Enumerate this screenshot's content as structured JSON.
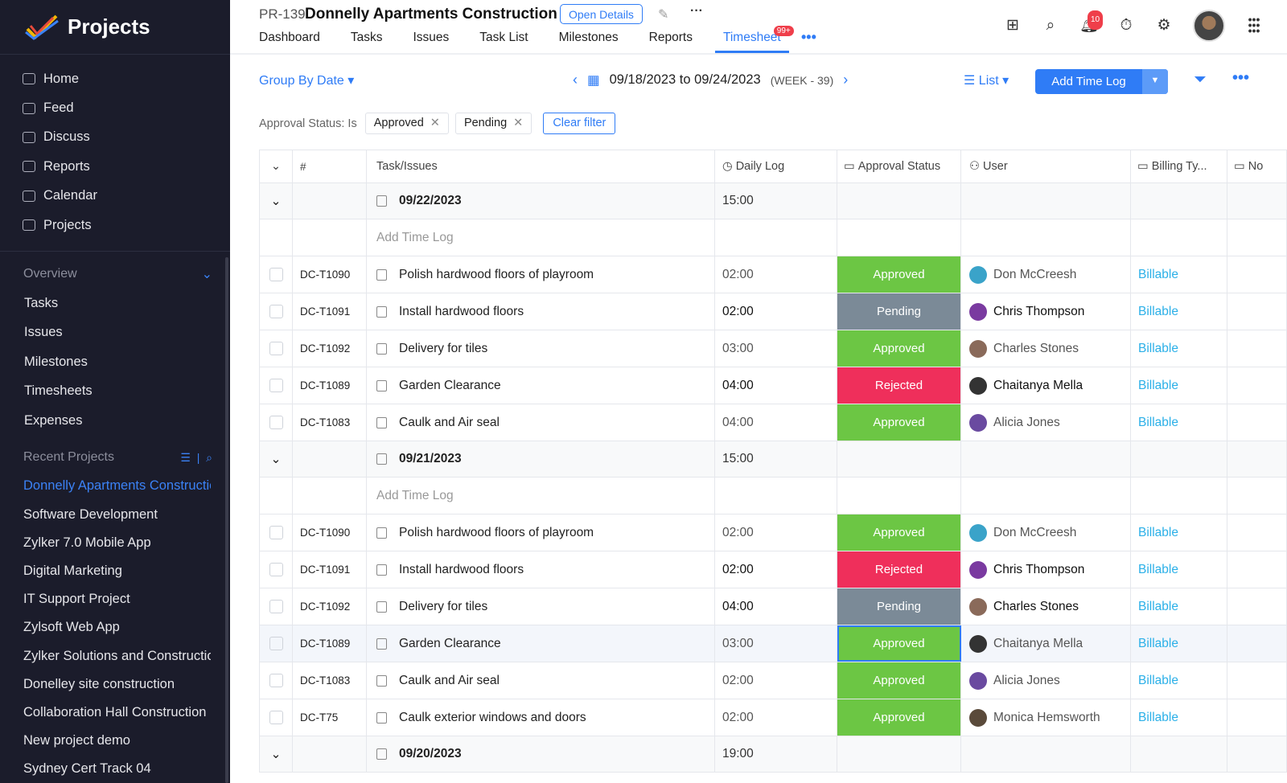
{
  "app": {
    "title": "Projects"
  },
  "sidebar": {
    "items": [
      {
        "label": "Home"
      },
      {
        "label": "Feed"
      },
      {
        "label": "Discuss"
      },
      {
        "label": "Reports"
      },
      {
        "label": "Calendar"
      },
      {
        "label": "Projects"
      }
    ],
    "overview": {
      "title": "Overview",
      "items": [
        {
          "label": "Tasks"
        },
        {
          "label": "Issues"
        },
        {
          "label": "Milestones"
        },
        {
          "label": "Timesheets"
        },
        {
          "label": "Expenses"
        }
      ]
    },
    "recent": {
      "title": "Recent Projects",
      "items": [
        {
          "label": "Donnelly Apartments Construction",
          "active": true
        },
        {
          "label": "Software Development"
        },
        {
          "label": "Zylker 7.0 Mobile App"
        },
        {
          "label": "Digital Marketing"
        },
        {
          "label": "IT Support Project"
        },
        {
          "label": "Zylsoft Web App"
        },
        {
          "label": "Zylker Solutions and Construction"
        },
        {
          "label": "Donelley site construction"
        },
        {
          "label": "Collaboration Hall Construction"
        },
        {
          "label": "New project demo"
        },
        {
          "label": "Sydney Cert Track 04"
        }
      ]
    }
  },
  "header": {
    "project_id": "PR-139",
    "project_title": "Donnelly Apartments Construction",
    "open_details": "Open Details",
    "tabs": [
      {
        "label": "Dashboard"
      },
      {
        "label": "Tasks"
      },
      {
        "label": "Issues"
      },
      {
        "label": "Task List"
      },
      {
        "label": "Milestones"
      },
      {
        "label": "Reports"
      },
      {
        "label": "Timesheet",
        "active": true,
        "badge": "99+"
      }
    ],
    "notifications": "10"
  },
  "toolbar": {
    "group_by": "Group By Date",
    "date_range": "09/18/2023 to 09/24/2023",
    "week": "(WEEK - 39)",
    "view": "List",
    "add_time_log": "Add Time Log"
  },
  "filters": {
    "label": "Approval Status: Is",
    "chips": [
      "Approved",
      "Pending"
    ],
    "clear": "Clear filter"
  },
  "table": {
    "columns": [
      "#",
      "Task/Issues",
      "Daily Log",
      "Approval Status",
      "User",
      "Billing Ty...",
      "No"
    ],
    "add_time_log": "Add Time Log",
    "groups": [
      {
        "date": "09/22/2023",
        "total": "15:00",
        "rows": [
          {
            "id": "DC-T1090",
            "task": "Polish hardwood floors of playroom",
            "log": "02:00",
            "status": "Approved",
            "user": "Don McCreesh",
            "billing": "Billable"
          },
          {
            "id": "DC-T1091",
            "task": "Install hardwood floors",
            "log": "02:00",
            "status": "Pending",
            "user": "Chris Thompson",
            "billing": "Billable",
            "strong": true
          },
          {
            "id": "DC-T1092",
            "task": "Delivery for tiles",
            "log": "03:00",
            "status": "Approved",
            "user": "Charles Stones",
            "billing": "Billable"
          },
          {
            "id": "DC-T1089",
            "task": "Garden Clearance",
            "log": "04:00",
            "status": "Rejected",
            "user": "Chaitanya Mella",
            "billing": "Billable",
            "strong": true
          },
          {
            "id": "DC-T1083",
            "task": "Caulk and Air seal",
            "log": "04:00",
            "status": "Approved",
            "user": "Alicia Jones",
            "billing": "Billable"
          }
        ]
      },
      {
        "date": "09/21/2023",
        "total": "15:00",
        "rows": [
          {
            "id": "DC-T1090",
            "task": "Polish hardwood floors of playroom",
            "log": "02:00",
            "status": "Approved",
            "user": "Don McCreesh",
            "billing": "Billable"
          },
          {
            "id": "DC-T1091",
            "task": "Install hardwood floors",
            "log": "02:00",
            "status": "Rejected",
            "user": "Chris Thompson",
            "billing": "Billable",
            "strong": true
          },
          {
            "id": "DC-T1092",
            "task": "Delivery for tiles",
            "log": "04:00",
            "status": "Pending",
            "user": "Charles Stones",
            "billing": "Billable",
            "strong": true
          },
          {
            "id": "DC-T1089",
            "task": "Garden Clearance",
            "log": "03:00",
            "status": "Approved",
            "user": "Chaitanya Mella",
            "billing": "Billable",
            "selected": true
          },
          {
            "id": "DC-T1083",
            "task": "Caulk and Air seal",
            "log": "02:00",
            "status": "Approved",
            "user": "Alicia Jones",
            "billing": "Billable"
          },
          {
            "id": "DC-T75",
            "task": "Caulk exterior windows and doors",
            "log": "02:00",
            "status": "Approved",
            "user": "Monica Hemsworth",
            "billing": "Billable"
          }
        ]
      },
      {
        "date": "09/20/2023",
        "total": "19:00",
        "rows": []
      }
    ]
  },
  "colors": {
    "accent": "#2f7cf6",
    "Approved": "#6cc644",
    "Pending": "#7b8a97",
    "Rejected": "#ef2f5b",
    "billable": "#2bb0e8",
    "sidebar": "#1b1c2b"
  }
}
